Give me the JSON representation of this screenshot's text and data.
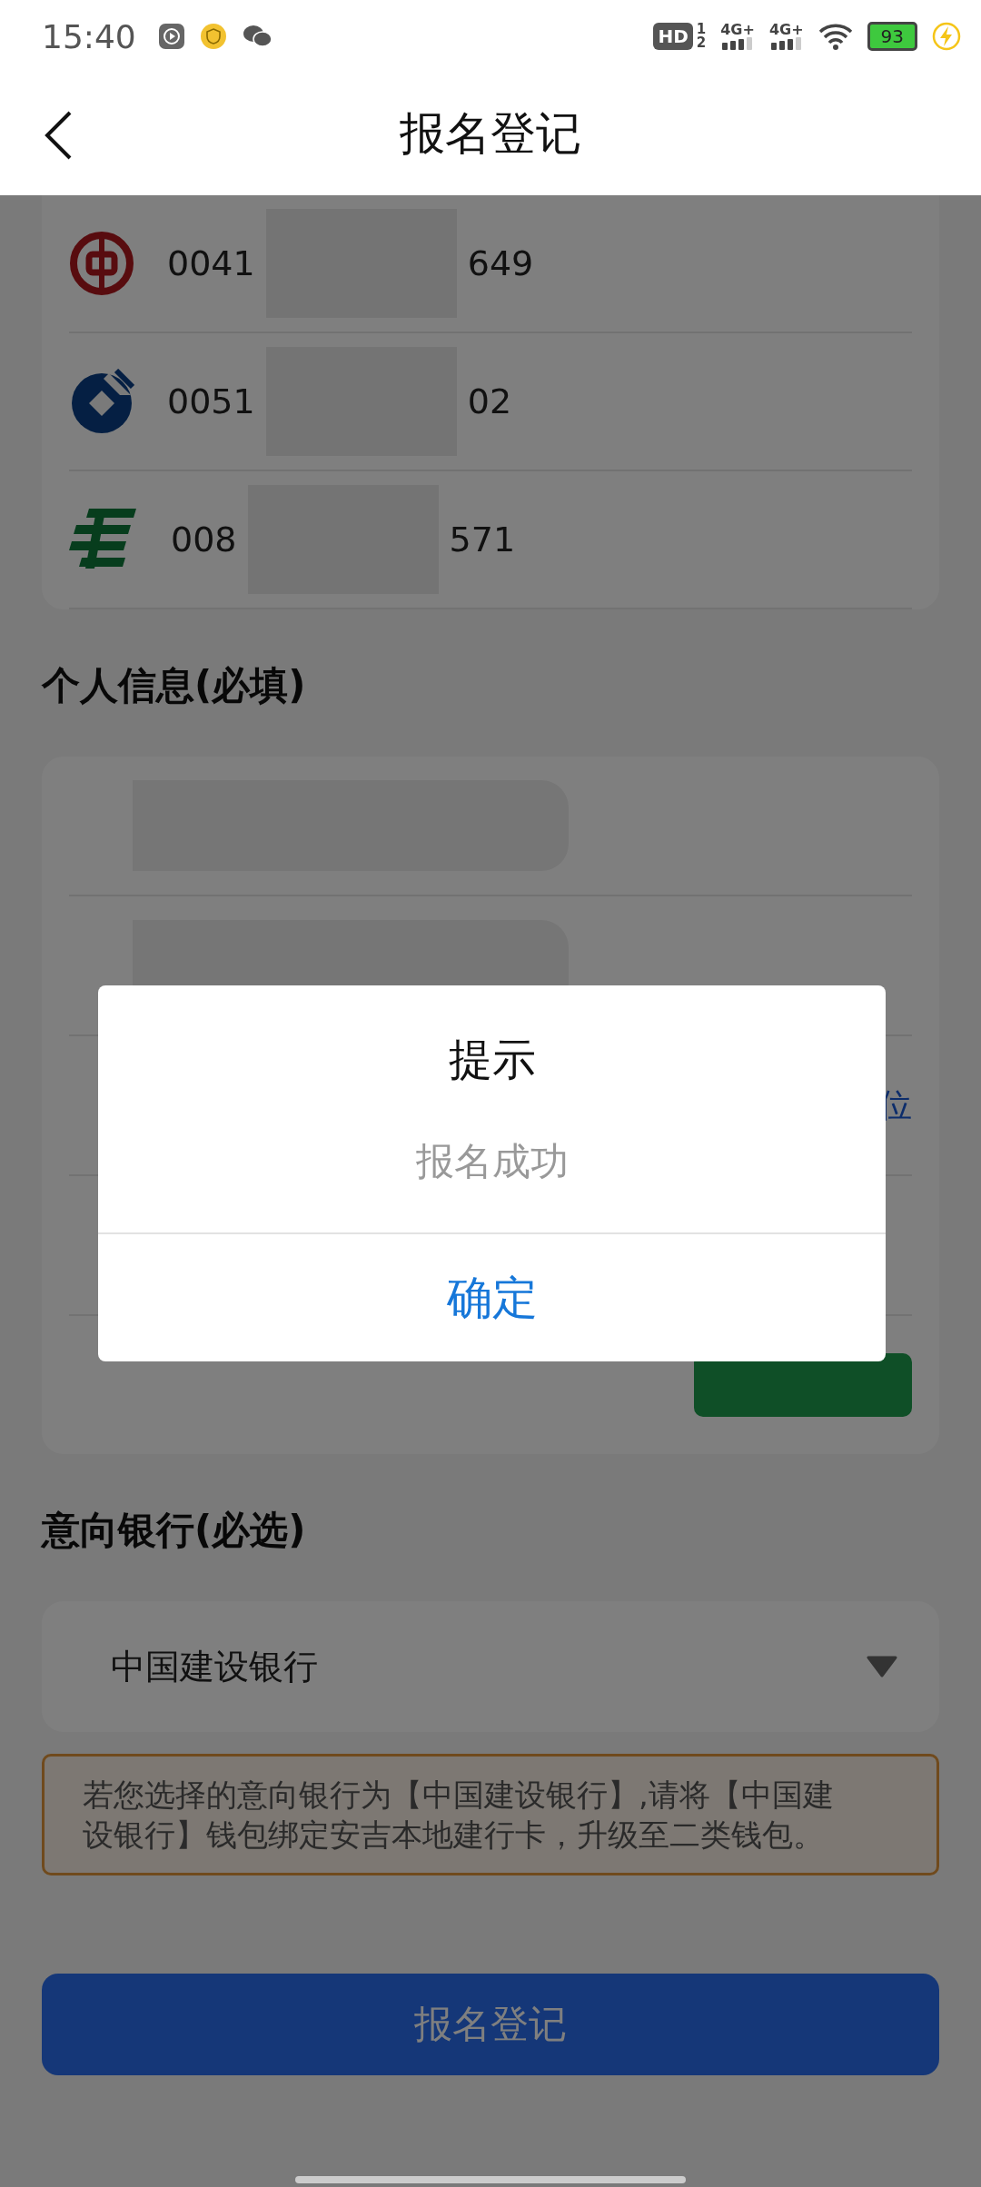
{
  "status_bar": {
    "time": "15:40",
    "hd": "HD",
    "sims": [
      "1",
      "2"
    ],
    "networks": [
      "4G+",
      "4G+"
    ],
    "battery": "93",
    "charging": true
  },
  "header": {
    "title": "报名登记"
  },
  "bank_accounts": [
    {
      "kind": "boc",
      "number_start": "0041",
      "number_end": "649"
    },
    {
      "kind": "ccb",
      "number_start": "0051",
      "number_end": "02"
    },
    {
      "kind": "post",
      "number_start": "008",
      "number_end": "571"
    }
  ],
  "personal_info": {
    "title": "个人信息(必填)",
    "rows": [
      {
        "kind": "masked"
      },
      {
        "kind": "masked"
      },
      {
        "kind": "link",
        "link": "位"
      },
      {
        "kind": "blank"
      },
      {
        "kind": "code_button"
      }
    ]
  },
  "bank_choice": {
    "title": "意向银行(必选)",
    "value": "中国建设银行"
  },
  "notice": "若您选择的意向银行为【中国建设银行】,请将【中国建设银行】钱包绑定安吉本地建行卡，升级至二类钱包。",
  "submit": "报名登记",
  "dialog": {
    "title": "提示",
    "message": "报名成功",
    "confirm": "确定"
  }
}
